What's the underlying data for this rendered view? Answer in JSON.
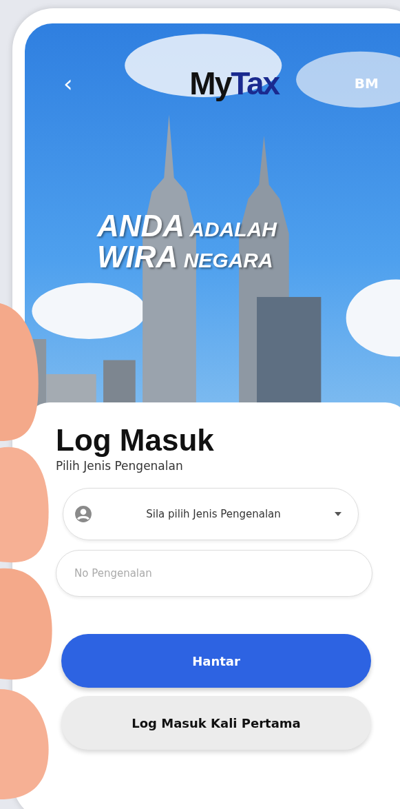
{
  "header": {
    "back": "‹",
    "logo_first": "My",
    "logo_second": "Tax",
    "language": "BM"
  },
  "banner": {
    "lines": [
      "**ANDA** ADALAH",
      "**WIRA** NEGARA"
    ]
  },
  "login": {
    "title": "Log Masuk",
    "subtitle": "Pilih Jenis Pengenalan",
    "id_type_select": {
      "placeholder": "Sila pilih Jenis Pengenalan"
    },
    "id_number_field": {
      "placeholder": "No Pengenalan"
    },
    "buttons": [
      {
        "label": "Hantar",
        "kind": "primary"
      },
      {
        "label": "Log Masuk Kali Pertama",
        "kind": "secondary"
      }
    ]
  }
}
